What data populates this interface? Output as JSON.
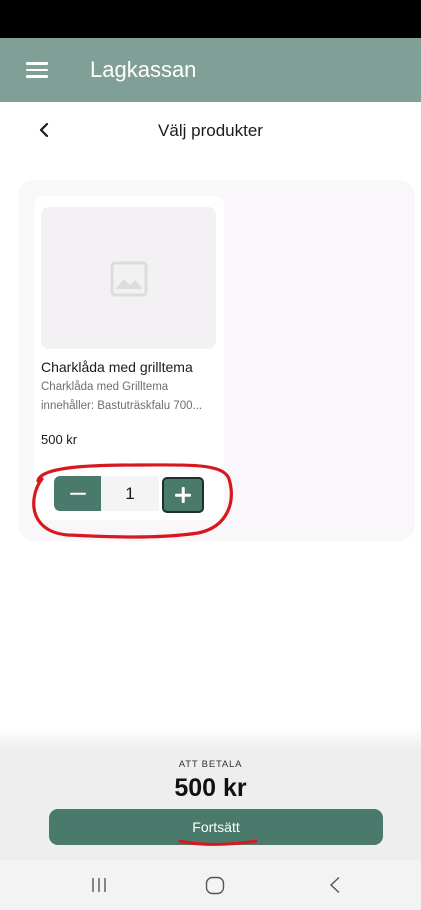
{
  "app": {
    "title": "Lagkassan"
  },
  "header": {
    "title": "Välj produkter"
  },
  "product": {
    "name": "Charklåda med grilltema",
    "description_line1": "Charklåda med Grilltema",
    "description_line2": "innehåller: Bastuträskfalu 700...",
    "price": "500 kr",
    "quantity": "1"
  },
  "checkout": {
    "total_label": "ATT BETALA",
    "total_value": "500 kr",
    "continue_label": "Fortsätt"
  },
  "icons": {
    "menu": "menu-icon",
    "back": "chevron-left-icon",
    "image_placeholder": "image-icon",
    "minus": "minus-icon",
    "plus": "plus-icon",
    "nav_recents": "recents-icon",
    "nav_home": "home-icon",
    "nav_back": "back-icon"
  },
  "colors": {
    "appbar": "#7f9f97",
    "accent": "#4a7a6b",
    "annotation": "#d7191f"
  }
}
